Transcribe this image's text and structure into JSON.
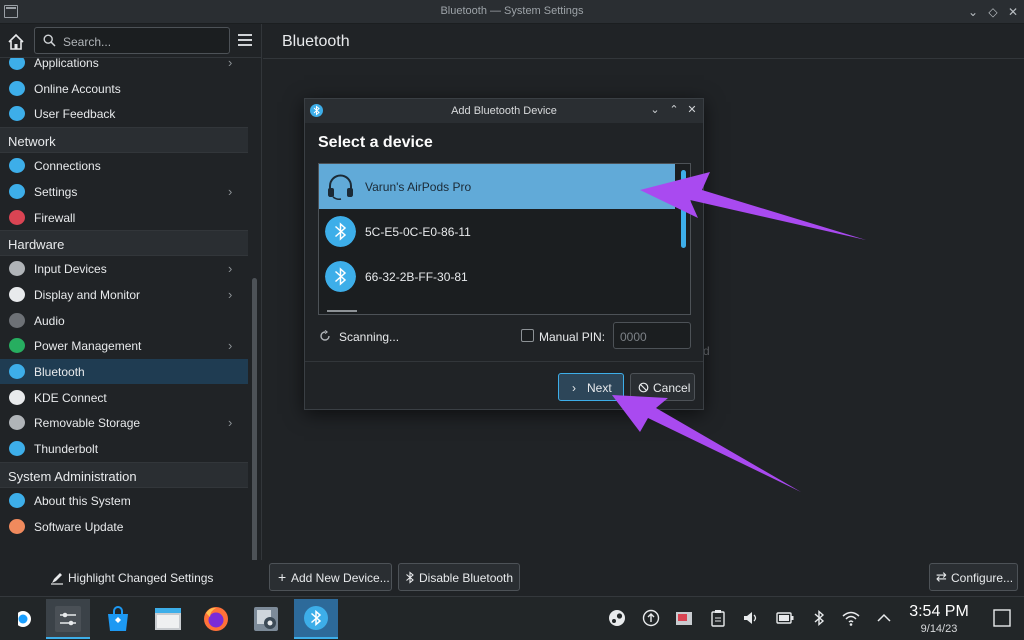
{
  "window": {
    "title": "Bluetooth — System Settings",
    "controls": [
      "chevron-down",
      "restore",
      "close"
    ]
  },
  "sidebar": {
    "search_placeholder": "Search...",
    "items": [
      {
        "label": "Applications",
        "icon": "applications-icon",
        "chevron": true
      },
      {
        "label": "Online Accounts",
        "icon": "online-accounts-icon",
        "chevron": false
      },
      {
        "label": "User Feedback",
        "icon": "user-feedback-icon",
        "chevron": false
      },
      {
        "section": "Network"
      },
      {
        "label": "Connections",
        "icon": "connections-icon",
        "chevron": false
      },
      {
        "label": "Settings",
        "icon": "network-settings-icon",
        "chevron": true
      },
      {
        "label": "Firewall",
        "icon": "firewall-icon",
        "chevron": false
      },
      {
        "section": "Hardware"
      },
      {
        "label": "Input Devices",
        "icon": "input-devices-icon",
        "chevron": true
      },
      {
        "label": "Display and Monitor",
        "icon": "display-icon",
        "chevron": true
      },
      {
        "label": "Audio",
        "icon": "audio-icon",
        "chevron": false
      },
      {
        "label": "Power Management",
        "icon": "power-icon",
        "chevron": true
      },
      {
        "label": "Bluetooth",
        "icon": "bluetooth-icon",
        "chevron": false,
        "active": true
      },
      {
        "label": "KDE Connect",
        "icon": "kde-connect-icon",
        "chevron": false
      },
      {
        "label": "Removable Storage",
        "icon": "removable-storage-icon",
        "chevron": true
      },
      {
        "label": "Thunderbolt",
        "icon": "thunderbolt-icon",
        "chevron": false
      },
      {
        "section": "System Administration"
      },
      {
        "label": "About this System",
        "icon": "about-icon",
        "chevron": false
      },
      {
        "label": "Software Update",
        "icon": "software-update-icon",
        "chevron": false
      }
    ]
  },
  "main": {
    "page_title": "Bluetooth"
  },
  "dialog": {
    "title": "Add Bluetooth Device",
    "heading": "Select a device",
    "devices": [
      {
        "name": "Varun's AirPods Pro",
        "icon": "headset-icon",
        "selected": true
      },
      {
        "name": "5C-E5-0C-E0-86-11",
        "icon": "bluetooth-icon",
        "selected": false
      },
      {
        "name": "66-32-2B-FF-30-81",
        "icon": "bluetooth-icon",
        "selected": false
      }
    ],
    "scanning_label": "Scanning...",
    "manual_pin_label": "Manual PIN:",
    "pin_placeholder": "0000",
    "next_label": "Next",
    "cancel_label": "Cancel"
  },
  "actionbar": {
    "highlight_label": "Highlight Changed Settings",
    "add_device_label": "Add New Device...",
    "disable_bt_label": "Disable Bluetooth",
    "configure_label": "Configure..."
  },
  "taskbar": {
    "time": "3:54 PM",
    "date": "9/14/23"
  },
  "colors": {
    "accent": "#3daee9",
    "selection": "#61aad8",
    "annotation_arrow": "#a94af0"
  }
}
